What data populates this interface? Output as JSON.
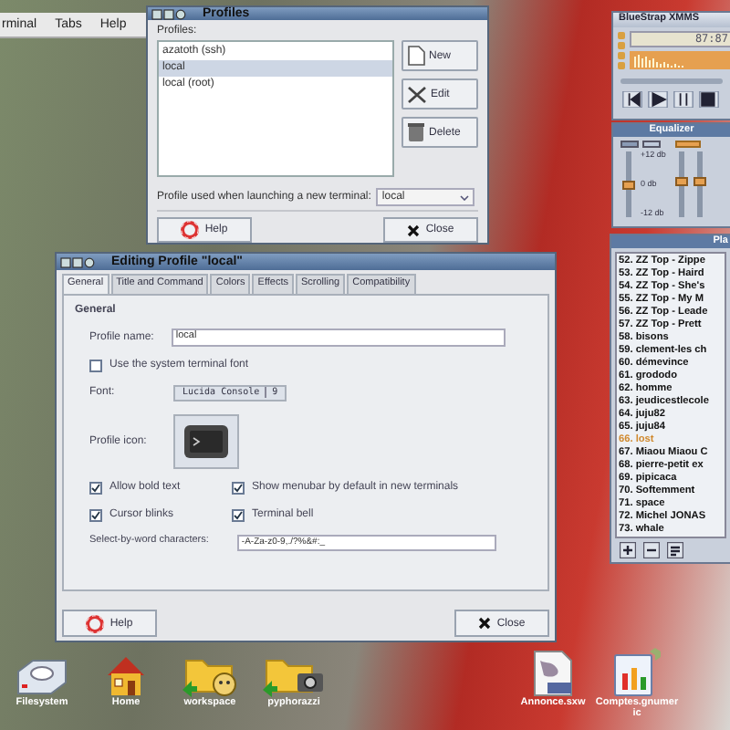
{
  "terminal_window": {
    "menu": [
      "rminal",
      "Tabs",
      "Help"
    ]
  },
  "profiles_window": {
    "title": "Profiles",
    "list_label": "Profiles:",
    "profiles": [
      {
        "name": "azatoth (ssh)",
        "selected": false
      },
      {
        "name": "local",
        "selected": true
      },
      {
        "name": "local (root)",
        "selected": false
      }
    ],
    "buttons": [
      {
        "label": "New",
        "kind": "new"
      },
      {
        "label": "Edit",
        "kind": "edit"
      },
      {
        "label": "Delete",
        "kind": "delete"
      }
    ],
    "default_label": "Profile used when launching a new terminal:",
    "default_value": "local",
    "footer_buttons": [
      {
        "label": "Help",
        "kind": "help"
      },
      {
        "label": "Close",
        "kind": "close"
      }
    ]
  },
  "editor_window": {
    "title": "Editing Profile \"local\"",
    "tabs": [
      {
        "label": "General",
        "selected": true
      },
      {
        "label": "Title and Command",
        "selected": false
      },
      {
        "label": "Colors",
        "selected": false
      },
      {
        "label": "Effects",
        "selected": false
      },
      {
        "label": "Scrolling",
        "selected": false
      },
      {
        "label": "Compatibility",
        "selected": false
      }
    ],
    "section": "General",
    "profile_name": {
      "label": "Profile name:",
      "value": "local"
    },
    "system_font": {
      "label": "Use the system terminal font",
      "checked": false
    },
    "font": {
      "label": "Font:",
      "name": "Lucida Console",
      "size": "9"
    },
    "icon_label": "Profile icon:",
    "options": [
      {
        "label": "Allow bold text",
        "checked": true
      },
      {
        "label": "Show menubar by default in new terminals",
        "checked": true
      },
      {
        "label": "Cursor blinks",
        "checked": true
      },
      {
        "label": "Terminal bell",
        "checked": true
      }
    ],
    "word_chars": {
      "label": "Select-by-word characters:",
      "value": "-A-Za-z0-9,./?%&#:_"
    },
    "footer_buttons": [
      {
        "label": "Help",
        "kind": "help"
      },
      {
        "label": "Close",
        "kind": "close"
      }
    ]
  },
  "xmms": {
    "title": "BlueStrap XMMS",
    "time": "87:87"
  },
  "equalizer": {
    "title": "Equalizer",
    "scale": [
      "+12 db",
      "0 db",
      "-12 db"
    ],
    "bands": [
      {
        "level": 0.5
      },
      {
        "level": 0.55
      },
      {
        "level": 0.55
      }
    ]
  },
  "playlist": {
    "title": "Pla",
    "tracks": [
      {
        "label": "52. ZZ Top - Zippe",
        "selected": false
      },
      {
        "label": "53. ZZ Top - Haird",
        "selected": false
      },
      {
        "label": "54. ZZ Top - She's",
        "selected": false
      },
      {
        "label": "55. ZZ Top - My M",
        "selected": false
      },
      {
        "label": "56. ZZ Top - Leade",
        "selected": false
      },
      {
        "label": "57. ZZ Top - Prett",
        "selected": false
      },
      {
        "label": "58. bisons",
        "selected": false
      },
      {
        "label": "59. clement-les ch",
        "selected": false
      },
      {
        "label": "60. démevince",
        "selected": false
      },
      {
        "label": "61. grododo",
        "selected": false
      },
      {
        "label": "62. homme",
        "selected": false
      },
      {
        "label": "63. jeudicestlecole",
        "selected": false
      },
      {
        "label": "64. juju82",
        "selected": false
      },
      {
        "label": "65. juju84",
        "selected": false
      },
      {
        "label": "66. lost",
        "selected": true
      },
      {
        "label": "67. Miaou Miaou C",
        "selected": false
      },
      {
        "label": "68. pierre-petit ex",
        "selected": false
      },
      {
        "label": "69. pipicaca",
        "selected": false
      },
      {
        "label": "70. Softemment",
        "selected": false
      },
      {
        "label": "71. space",
        "selected": false
      },
      {
        "label": "72. Michel JONAS",
        "selected": false
      },
      {
        "label": "73. whale",
        "selected": false
      }
    ]
  },
  "desktop_icons": [
    {
      "label": "Filesystem",
      "kind": "drive"
    },
    {
      "label": "Home",
      "kind": "home"
    },
    {
      "label": "workspace",
      "kind": "folder"
    },
    {
      "label": "pyphorazzi",
      "kind": "folder-camera"
    },
    {
      "label": "Annonce.sxw",
      "kind": "document"
    },
    {
      "label": "Comptes.gnumeric",
      "kind": "spreadsheet"
    }
  ]
}
